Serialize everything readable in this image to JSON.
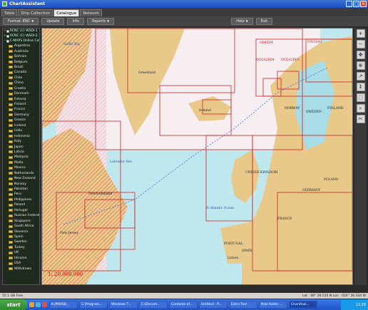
{
  "window": {
    "title": "ChartAssistant"
  },
  "tabs": [
    {
      "label": "Table",
      "active": false
    },
    {
      "label": "Ship Collection",
      "active": false
    },
    {
      "label": "Catalogue",
      "active": true
    },
    {
      "label": "Network",
      "active": false
    }
  ],
  "toolbar": {
    "format_label": "Format: ENC",
    "update_label": "Update",
    "info_label": "Info",
    "reports_label": "Reports",
    "help_label": "Help",
    "exit_label": "Exit"
  },
  "sidebar": {
    "roots": [
      "RCNC (C) WSDI-1",
      "RCNC (C) WSDI-2",
      "C-MAPS Online Catalogue"
    ],
    "countries": [
      "Argentina",
      "Australia",
      "Bahrain",
      "Belgium",
      "Brazil",
      "Canada",
      "Chile",
      "China",
      "Croatia",
      "Denmark",
      "Estonia",
      "Finland",
      "France",
      "Germany",
      "Greece",
      "Iceland",
      "India",
      "Indonesia",
      "Italy",
      "Japan",
      "Latvia",
      "Malaysia",
      "Malta",
      "Mexico",
      "Netherlands",
      "New Zealand",
      "Norway",
      "Pakistan",
      "Peru",
      "Philippines",
      "Poland",
      "Portugal",
      "Russian Federation",
      "Singapore",
      "South Africa",
      "Slovenia",
      "Spain",
      "Sweden",
      "Turkey",
      "UK",
      "Ukraine",
      "USA",
      "Withdrawn"
    ]
  },
  "map": {
    "scale": "1: 20,000,000",
    "labels": {
      "baffin": "Baffin Bay",
      "greenland": "Greenland",
      "iceland": "Iceland",
      "labrador": "Labrador Sea",
      "atlantic": "N Atlantic Ocean",
      "norway": "NORWAY",
      "sweden": "SWEDEN",
      "finland": "FINLAND",
      "uk": "UNITED KINGDOM",
      "france": "FRANCE",
      "spain": "SPAIN",
      "portugal": "PORTUGAL",
      "germany": "GERMANY",
      "poland": "POLAND",
      "newfoundland": "Newfoundland",
      "newjersey": "New Jersey",
      "lisbon": "Lisbon",
      "chart1": "FIN50A1",
      "chart2": "NO2A2B04",
      "chart3": "NO2A2B05",
      "chart4": "GB4X04"
    }
  },
  "status": {
    "left": "55.1 GB Free",
    "right": "Lat : 46° 26.535 N Lon : 024° 36.334 W"
  },
  "taskbar": {
    "start_label": "start",
    "tasks": [
      "8 JPNHSB...",
      "C:\\Program...",
      "Windows T...",
      "C:\\Docum...",
      "Contents of...",
      "Untitled - P...",
      "Extra Tool",
      "New folder ...",
      "ChartAssi..."
    ],
    "clock": "12:29"
  },
  "colors": {
    "land": "#e8c98a",
    "sea": "#bfe8ee",
    "deep_sea": "#ffffff",
    "chart_outline": "#d42020",
    "route": "#4a6ad8"
  }
}
